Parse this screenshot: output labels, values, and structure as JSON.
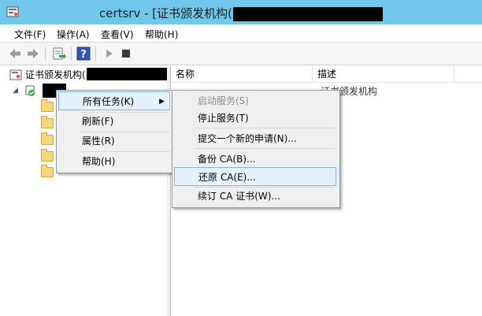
{
  "window": {
    "title": "certsrv - [证书颁发机构(",
    "colors": {
      "titlebar": "#71c6eb",
      "highlight": "#e5f1fb",
      "highlight_border": "#7eb4ea"
    }
  },
  "menubar": {
    "items": [
      {
        "label": "文件(F)"
      },
      {
        "label": "操作(A)"
      },
      {
        "label": "查看(V)"
      },
      {
        "label": "帮助(H)"
      }
    ]
  },
  "toolbar": {
    "icons": [
      "back-arrow-icon",
      "forward-arrow-icon",
      "export-list-icon",
      "help-icon",
      "start-service-icon",
      "stop-service-icon"
    ]
  },
  "tree": {
    "root_label": "证书颁发机构(",
    "visible_child_fragment": "— — —"
  },
  "list": {
    "columns": [
      {
        "label": "名称"
      },
      {
        "label": "描述"
      }
    ],
    "partial_row_description": "证书颁发机构"
  },
  "context_menu": {
    "items": [
      {
        "label": "所有任务(K)",
        "has_submenu": true
      },
      {
        "label": "刷新(F)"
      },
      {
        "label": "属性(R)"
      },
      {
        "label": "帮助(H)"
      }
    ]
  },
  "submenu": {
    "items": [
      {
        "label": "启动服务(S)",
        "disabled": true
      },
      {
        "label": "停止服务(T)"
      },
      {
        "label": "提交一个新的申请(N)..."
      },
      {
        "label": "备份 CA(B)..."
      },
      {
        "label": "还原 CA(E)...",
        "highlighted": true
      },
      {
        "label": "续订 CA 证书(W)..."
      }
    ]
  }
}
